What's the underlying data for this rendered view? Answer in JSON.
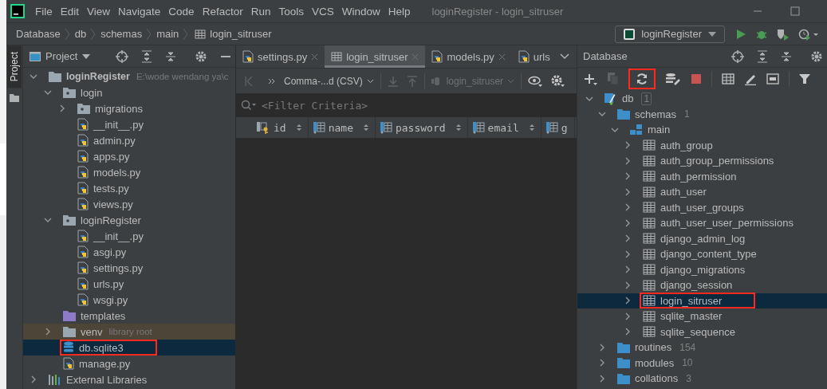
{
  "window": {
    "title": "loginRegister - login_sitruser"
  },
  "menu": [
    "File",
    "Edit",
    "View",
    "Navigate",
    "Code",
    "Refactor",
    "Run",
    "Tools",
    "VCS",
    "Window",
    "Help"
  ],
  "breadcrumbs": [
    {
      "label": "Database",
      "kind": "node"
    },
    {
      "label": "db",
      "kind": "node"
    },
    {
      "label": "schemas",
      "kind": "node"
    },
    {
      "label": "main",
      "kind": "node"
    },
    {
      "label": "login_sitruser",
      "kind": "table"
    }
  ],
  "run_config": {
    "label": "loginRegister"
  },
  "project": {
    "side_label": "Project",
    "title": "Project",
    "tree": [
      {
        "label": "loginRegister",
        "kind": "project-root",
        "hint": "E:\\wode wendang ya\\c",
        "expanded": true,
        "selected": false,
        "highlighted": false,
        "children": [
          {
            "label": "login",
            "kind": "package",
            "expanded": true,
            "selected": false,
            "highlighted": false,
            "children": [
              {
                "label": "migrations",
                "kind": "package",
                "expanded": false,
                "selected": false,
                "highlighted": false
              },
              {
                "label": "__init__.py",
                "kind": "python",
                "selected": false,
                "highlighted": false
              },
              {
                "label": "admin.py",
                "kind": "python",
                "selected": false,
                "highlighted": false
              },
              {
                "label": "apps.py",
                "kind": "python",
                "selected": false,
                "highlighted": false
              },
              {
                "label": "models.py",
                "kind": "python",
                "selected": false,
                "highlighted": false
              },
              {
                "label": "tests.py",
                "kind": "python",
                "selected": false,
                "highlighted": false
              },
              {
                "label": "views.py",
                "kind": "python",
                "selected": false,
                "highlighted": false
              }
            ]
          },
          {
            "label": "loginRegister",
            "kind": "package",
            "expanded": true,
            "selected": false,
            "highlighted": false,
            "children": [
              {
                "label": "__init__.py",
                "kind": "python",
                "selected": false,
                "highlighted": false
              },
              {
                "label": "asgi.py",
                "kind": "python",
                "selected": false,
                "highlighted": false
              },
              {
                "label": "settings.py",
                "kind": "python",
                "selected": false,
                "highlighted": false
              },
              {
                "label": "urls.py",
                "kind": "python",
                "selected": false,
                "highlighted": false
              },
              {
                "label": "wsgi.py",
                "kind": "python",
                "selected": false,
                "highlighted": false
              }
            ]
          },
          {
            "label": "templates",
            "kind": "templates",
            "selected": false,
            "highlighted": false
          },
          {
            "label": "venv",
            "kind": "venv",
            "hint": "library root",
            "expanded": false,
            "selected": false,
            "highlighted": false
          },
          {
            "label": "db.sqlite3",
            "kind": "database",
            "selected": true,
            "highlighted": true
          },
          {
            "label": "manage.py",
            "kind": "python",
            "selected": false,
            "highlighted": false
          }
        ]
      },
      {
        "label": "External Libraries",
        "kind": "libraries",
        "expanded": false,
        "selected": false,
        "highlighted": false
      }
    ]
  },
  "editor": {
    "tabs": [
      {
        "label": "settings.py",
        "kind": "python",
        "selected": false,
        "closable": true
      },
      {
        "label": "login_sitruser",
        "kind": "table",
        "selected": true,
        "closable": true
      },
      {
        "label": "models.py",
        "kind": "python",
        "selected": false,
        "closable": true
      },
      {
        "label": "urls",
        "kind": "python",
        "selected": false,
        "closable": false
      }
    ],
    "format": "Comma-...d (CSV)",
    "table": "login_sitruser",
    "filter": {
      "placeholder": "<Filter Criteria>"
    },
    "columns": [
      {
        "label": "id",
        "kind": "key"
      },
      {
        "label": "name",
        "kind": "column"
      },
      {
        "label": "password",
        "kind": "column"
      },
      {
        "label": "email",
        "kind": "column"
      },
      {
        "label": "g",
        "kind": "column"
      }
    ]
  },
  "database": {
    "title": "Database",
    "refresh_highlighted": true,
    "tree": [
      {
        "label": "db",
        "kind": "datasource",
        "count": "1",
        "expanded": true,
        "selected": false,
        "highlighted": false,
        "children": [
          {
            "label": "schemas",
            "kind": "folder",
            "count": "1",
            "expanded": true,
            "selected": false,
            "highlighted": false,
            "children": [
              {
                "label": "main",
                "kind": "schema",
                "expanded": true,
                "selected": false,
                "highlighted": false,
                "children": [
                  {
                    "label": "auth_group",
                    "kind": "table",
                    "expanded": false,
                    "selected": false,
                    "highlighted": false
                  },
                  {
                    "label": "auth_group_permissions",
                    "kind": "table",
                    "expanded": false,
                    "selected": false,
                    "highlighted": false
                  },
                  {
                    "label": "auth_permission",
                    "kind": "table",
                    "expanded": false,
                    "selected": false,
                    "highlighted": false
                  },
                  {
                    "label": "auth_user",
                    "kind": "table",
                    "expanded": false,
                    "selected": false,
                    "highlighted": false
                  },
                  {
                    "label": "auth_user_groups",
                    "kind": "table",
                    "expanded": false,
                    "selected": false,
                    "highlighted": false
                  },
                  {
                    "label": "auth_user_user_permissions",
                    "kind": "table",
                    "expanded": false,
                    "selected": false,
                    "highlighted": false
                  },
                  {
                    "label": "django_admin_log",
                    "kind": "table",
                    "expanded": false,
                    "selected": false,
                    "highlighted": false
                  },
                  {
                    "label": "django_content_type",
                    "kind": "table",
                    "expanded": false,
                    "selected": false,
                    "highlighted": false
                  },
                  {
                    "label": "django_migrations",
                    "kind": "table",
                    "expanded": false,
                    "selected": false,
                    "highlighted": false
                  },
                  {
                    "label": "django_session",
                    "kind": "table",
                    "expanded": false,
                    "selected": false,
                    "highlighted": false
                  },
                  {
                    "label": "login_sitruser",
                    "kind": "table",
                    "expanded": false,
                    "selected": true,
                    "highlighted": true
                  },
                  {
                    "label": "sqlite_master",
                    "kind": "table",
                    "expanded": false,
                    "selected": false,
                    "highlighted": false
                  },
                  {
                    "label": "sqlite_sequence",
                    "kind": "table",
                    "expanded": false,
                    "selected": false,
                    "highlighted": false
                  }
                ]
              }
            ]
          },
          {
            "label": "routines",
            "kind": "folder",
            "count": "154",
            "expanded": false,
            "selected": false,
            "highlighted": false
          },
          {
            "label": "modules",
            "kind": "folder",
            "count": "10",
            "expanded": false,
            "selected": false,
            "highlighted": false
          },
          {
            "label": "collations",
            "kind": "folder",
            "count": "3",
            "expanded": false,
            "selected": false,
            "highlighted": false
          }
        ]
      }
    ]
  }
}
